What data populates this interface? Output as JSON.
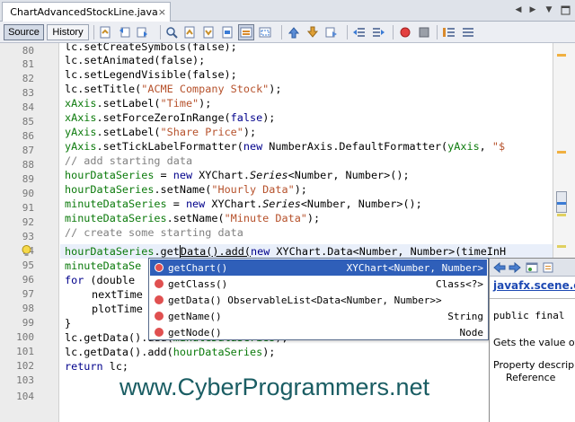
{
  "tab": {
    "label": "ChartAdvancedStockLine.java",
    "close": "×"
  },
  "toolbar": {
    "source_label": "Source",
    "history_label": "History"
  },
  "gutter": {
    "line_numbers": [
      "80",
      "81",
      "82",
      "83",
      "84",
      "85",
      "86",
      "87",
      "88",
      "89",
      "90",
      "91",
      "92",
      "93",
      "94",
      "95",
      "96",
      "97",
      "98",
      "99",
      "100",
      "101",
      "102",
      "103",
      "104"
    ]
  },
  "code": {
    "l80": "lc.setCreateSymbols(false);",
    "l81": "lc.setAnimated(false);",
    "l82": "lc.setLegendVisible(false);",
    "l83a": "lc.setTitle(",
    "l83b": "\"ACME Company Stock\"",
    "l83c": ");",
    "l84a": "xAxis",
    "l84b": ".setLabel(",
    "l84c": "\"Time\"",
    "l84d": ");",
    "l85a": "xAxis",
    "l85b": ".setForceZeroInRange(",
    "l85c": "false",
    "l85d": ");",
    "l86a": "yAxis",
    "l86b": ".setLabel(",
    "l86c": "\"Share Price\"",
    "l86d": ");",
    "l87a": "yAxis",
    "l87b": ".setTickLabelFormatter(",
    "l87c": "new",
    "l87d": " NumberAxis.DefaultFormatter(",
    "l87e": "yAxis",
    "l87f": ", ",
    "l87g": "\"$",
    "l88": "// add starting data",
    "l89a": "hourDataSeries",
    "l89b": " = ",
    "l89c": "new",
    "l89d": " XYChart.",
    "l89e": "Series",
    "l89f": "<Number, Number>();",
    "l90a": "hourDataSeries",
    "l90b": ".setName(",
    "l90c": "\"Hourly Data\"",
    "l90d": ");",
    "l91a": "minuteDataSeries",
    "l91b": " = ",
    "l91c": "new",
    "l91d": " XYChart.",
    "l91e": "Series",
    "l91f": "<Number, Number>();",
    "l92a": "minuteDataSeries",
    "l92b": ".setName(",
    "l92c": "\"Minute Data\"",
    "l92d": ");",
    "l93": "// create some starting data",
    "l94a": "hourDataSeries",
    "l94b": ".get",
    "l94c": "Data().add(",
    "l94d": "new",
    "l94e": " XYChart.Data<Number, Number>(timeInH",
    "l95": "minuteDataSe",
    "l96a": "for",
    "l96b": " (double",
    "l97": "nextTime",
    "l98": "plotTime",
    "l99": "}",
    "l100a": "lc.getData().add(",
    "l100b": "minuteDataSeries",
    "l100c": ");",
    "l101a": "lc.getData().add(",
    "l101b": "hourDataSeries",
    "l101c": ");",
    "l102a": "return",
    "l102b": " lc;",
    "l103": "}"
  },
  "completion": {
    "items": [
      {
        "name": "getChart()",
        "type": "XYChart<Number, Number>"
      },
      {
        "name": "getClass()",
        "type": "Class<?>"
      },
      {
        "name": "getData() ObservableList<Data<Number, Number>>",
        "type": ""
      },
      {
        "name": "getName()",
        "type": "String"
      },
      {
        "name": "getNode()",
        "type": "Node"
      }
    ]
  },
  "javadoc": {
    "link": "javafx.scene.c",
    "signature": "public final",
    "desc": "Gets the value of",
    "prop1": "Property descrip",
    "prop2": "Reference"
  },
  "watermark": "www.CyberProgrammers.net",
  "colors": {
    "keyword": "#00008b",
    "string": "#b6512b",
    "field": "#0b7a0b",
    "comment": "#808080",
    "selection": "#2f5fb9"
  }
}
